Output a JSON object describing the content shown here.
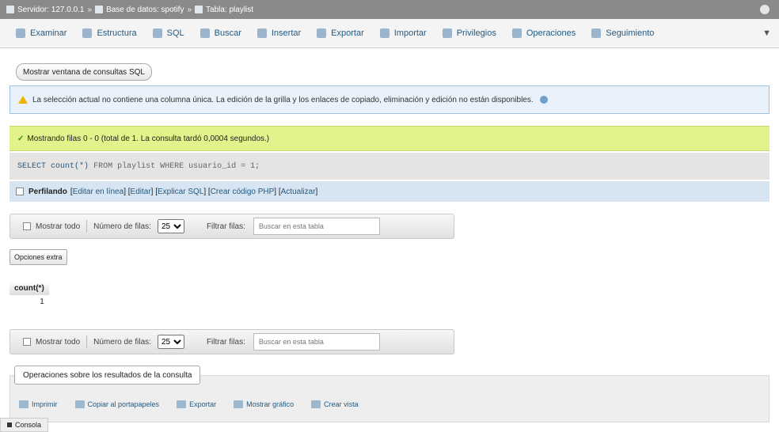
{
  "breadcrumb": {
    "server": "Servidor: 127.0.0.1",
    "database": "Base de datos: spotify",
    "table": "Tabla: playlist",
    "separator": "»"
  },
  "tabs": [
    {
      "label": "Examinar"
    },
    {
      "label": "Estructura"
    },
    {
      "label": "SQL"
    },
    {
      "label": "Buscar"
    },
    {
      "label": "Insertar"
    },
    {
      "label": "Exportar"
    },
    {
      "label": "Importar"
    },
    {
      "label": "Privilegios"
    },
    {
      "label": "Operaciones"
    },
    {
      "label": "Seguimiento"
    }
  ],
  "more_tab": "▼",
  "show_sql_button": "Mostrar ventana de consultas SQL",
  "notice_text": "La selección actual no contiene una columna única. La edición de la grilla y los enlaces de copiado, eliminación y edición no están disponibles.",
  "success_text": "Mostrando filas 0 - 0 (total de 1. La consulta tardó 0,0004 segundos.)",
  "sql": {
    "kw1": "SELECT",
    "fn": "count(*)",
    "kw2": "FROM",
    "table": "playlist",
    "kw3": "WHERE",
    "cond": "usuario_id = 1;"
  },
  "profiling": {
    "label": "Perfilando",
    "links": [
      "Editar en línea",
      "Editar",
      "Explicar SQL",
      "Crear código PHP",
      "Actualizar"
    ]
  },
  "nav": {
    "show_all": "Mostrar todo",
    "rows_label": "Número de filas:",
    "rows_value": "25",
    "filter_label": "Filtrar filas:",
    "filter_placeholder": "Buscar en esta tabla"
  },
  "extra_options": "Opciones extra",
  "result": {
    "header": "count(*)",
    "value": "1"
  },
  "operations": {
    "legend": "Operaciones sobre los resultados de la consulta",
    "actions": [
      "Imprimir",
      "Copiar al portapapeles",
      "Exportar",
      "Mostrar gráfico",
      "Crear vista"
    ]
  },
  "console": "Consola"
}
